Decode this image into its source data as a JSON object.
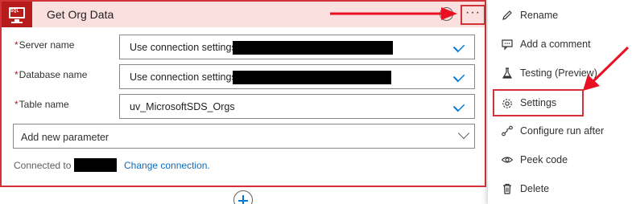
{
  "card": {
    "title": "Get Org Data",
    "connector_icon": "sql-server-icon",
    "connector_icon_label": "SQL",
    "more_label": "···",
    "border_color": "#d13438",
    "header_color": "#fbe0e0",
    "icon_color": "#b61c1c"
  },
  "fields": [
    {
      "label": "Server name",
      "required": "*",
      "value": "Use connection settings",
      "redacted": true
    },
    {
      "label": "Database name",
      "required": "*",
      "value": "Use connection settings",
      "redacted": true
    },
    {
      "label": "Table name",
      "required": "*",
      "value": "uv_MicrosoftSDS_Orgs",
      "redacted": false
    }
  ],
  "add_parameter": {
    "value": "Add new parameter"
  },
  "connection": {
    "prefix": "Connected to",
    "change_link": "Change connection."
  },
  "menu": {
    "items": [
      {
        "label": "Rename",
        "icon": "pencil-icon"
      },
      {
        "label": "Add a comment",
        "icon": "comment-icon"
      },
      {
        "label": "Testing (Preview)",
        "icon": "flask-icon"
      },
      {
        "label": "Settings",
        "icon": "gear-icon"
      },
      {
        "label": "Configure run after",
        "icon": "run-after-icon"
      },
      {
        "label": "Peek code",
        "icon": "eye-icon"
      },
      {
        "label": "Delete",
        "icon": "trash-icon"
      }
    ]
  },
  "accent_color": "#0078d4",
  "annotation_color": "#e81123"
}
